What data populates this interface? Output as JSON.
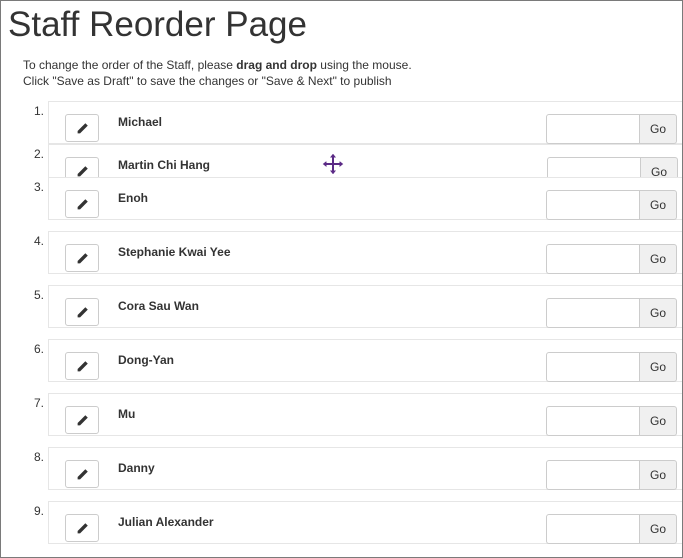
{
  "page": {
    "title": "Staff Reorder Page",
    "instructions": {
      "line1_before": "To change the order of the Staff, please ",
      "line1_bold": "drag and drop",
      "line1_after": " using the mouse.",
      "line2": "Click \"Save as Draft\" to save the changes or \"Save & Next\" to publish"
    }
  },
  "staff": [
    {
      "number": "1.",
      "name": "Michael",
      "go_value": "",
      "go_label": "Go"
    },
    {
      "number": "2.",
      "name": "Martin Chi Hang",
      "go_value": "",
      "go_label": "Go"
    },
    {
      "number": "3.",
      "name": "Enoh",
      "go_value": "",
      "go_label": "Go"
    },
    {
      "number": "4.",
      "name": "Stephanie Kwai Yee",
      "go_value": "",
      "go_label": "Go"
    },
    {
      "number": "5.",
      "name": "Cora Sau Wan",
      "go_value": "",
      "go_label": "Go"
    },
    {
      "number": "6.",
      "name": "Dong-Yan",
      "go_value": "",
      "go_label": "Go"
    },
    {
      "number": "7.",
      "name": "Mu",
      "go_value": "",
      "go_label": "Go"
    },
    {
      "number": "8.",
      "name": "Danny",
      "go_value": "",
      "go_label": "Go"
    },
    {
      "number": "9.",
      "name": "Julian Alexander",
      "go_value": "",
      "go_label": "Go"
    }
  ],
  "icons": {
    "edit": "pencil-icon",
    "cursor": "move-cursor-icon"
  },
  "colors": {
    "text": "#333333",
    "border": "#cccccc",
    "row_border": "#e6e6e6",
    "cursor_fill": "#5b2a86"
  }
}
